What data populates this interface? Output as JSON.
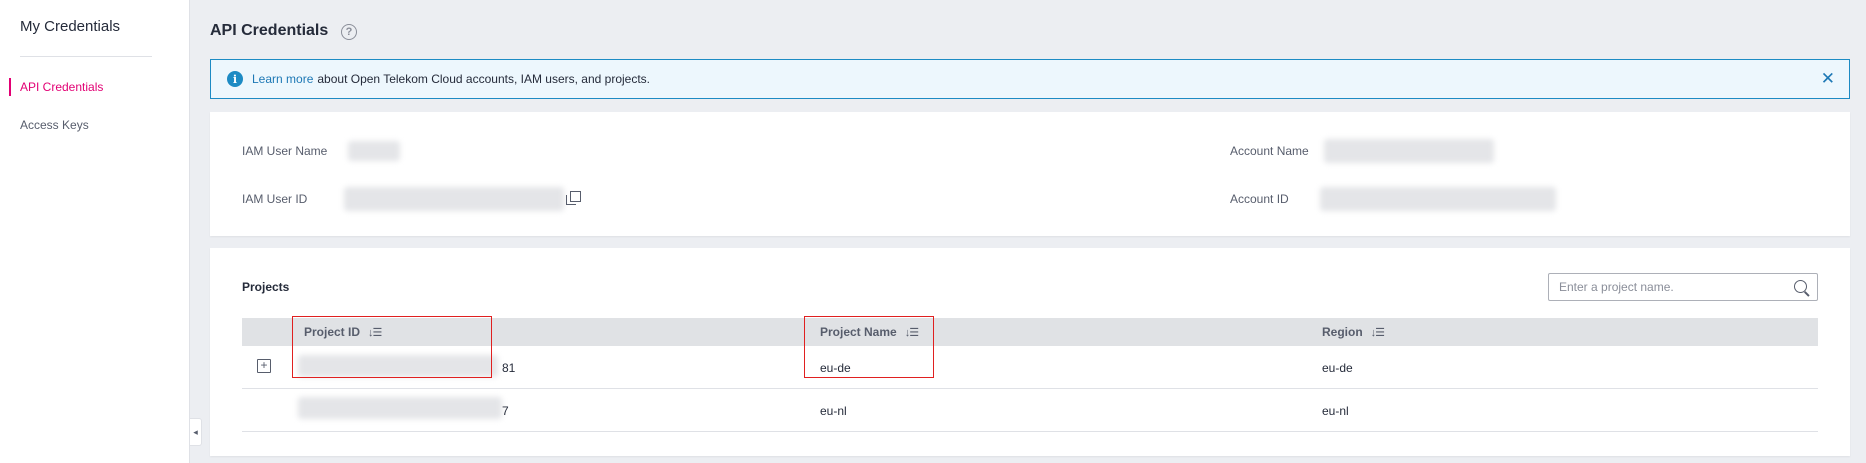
{
  "sidebar": {
    "title": "My Credentials",
    "items": [
      {
        "label": "API Credentials",
        "active": true
      },
      {
        "label": "Access Keys",
        "active": false
      }
    ],
    "collapse_glyph": "◂"
  },
  "header": {
    "title": "API Credentials",
    "help_glyph": "?"
  },
  "banner": {
    "link_text": "Learn more",
    "text": "about Open Telekom Cloud accounts, IAM users, and projects.",
    "icon": "info-icon",
    "close_glyph": "✕"
  },
  "user_info": {
    "iam_user_name_label": "IAM User Name",
    "iam_user_id_label": "IAM User ID",
    "account_name_label": "Account Name",
    "account_id_label": "Account ID"
  },
  "projects": {
    "title": "Projects",
    "search_placeholder": "Enter a project name.",
    "columns": [
      "Project ID",
      "Project Name",
      "Region"
    ],
    "sort_glyph": "↓☰",
    "rows": [
      {
        "project_id_suffix": "81",
        "project_name": "eu-de",
        "region": "eu-de",
        "expandable": true
      },
      {
        "project_id_suffix": "7",
        "project_name": "eu-nl",
        "region": "eu-nl",
        "expandable": false
      }
    ]
  },
  "colors": {
    "accent": "#e20074",
    "link": "#1d78b5",
    "highlight_box": "#e02020"
  }
}
